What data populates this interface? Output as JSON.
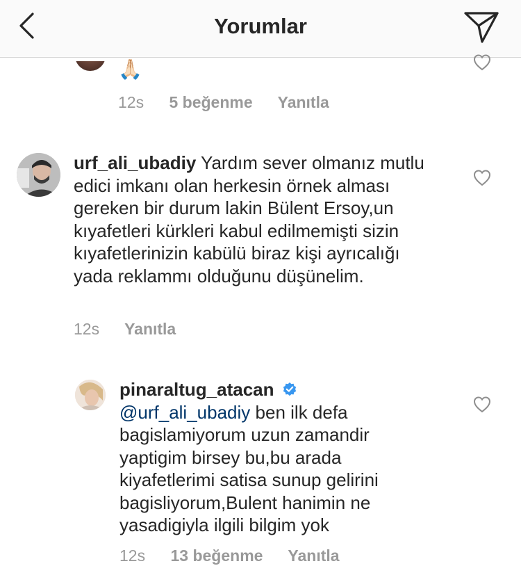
{
  "header": {
    "title": "Yorumlar"
  },
  "comments": [
    {
      "text": "🙏🏻",
      "time": "12s",
      "likes": "5 beğenme",
      "reply": "Yanıtla"
    },
    {
      "username": "urf_ali_ubadiy",
      "text": "Yardım sever olmanız mutlu edici imkanı olan herkesin örnek alması gereken bir durum lakin Bülent Ersoy,un kıyafetleri kürkleri kabul edilmemişti sizin kıyafetlerinizin kabülü biraz kişi ayrıcalığı yada reklammı olduğunu düşünelim.",
      "time": "12s",
      "reply": "Yanıtla"
    },
    {
      "username": "pinaraltug_atacan",
      "verified": true,
      "mention": "@urf_ali_ubadiy",
      "text": "ben ilk defa bagislamiyorum uzun zamandir yaptigim birsey bu,bu arada kiyafetlerimi satisa sunup gelirini bagisliyorum,Bulent hanimin ne yasadigiyla ilgili bilgim yok",
      "time": "12s",
      "likes": "13 beğenme",
      "reply": "Yanıtla"
    }
  ],
  "colors": {
    "header_bg": "#fafafa",
    "text": "#262626",
    "meta": "#999999",
    "mention": "#003569",
    "verified": "#3897f0"
  }
}
